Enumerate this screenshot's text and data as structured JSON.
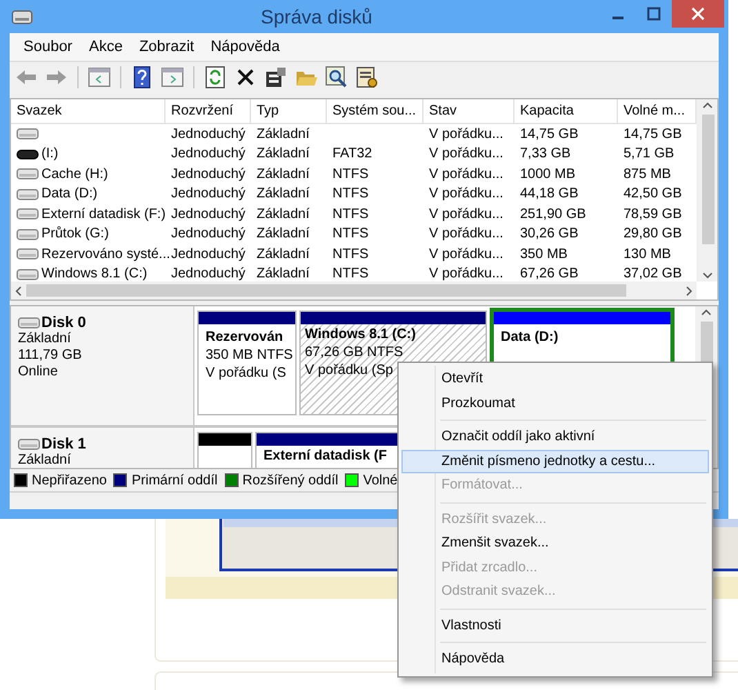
{
  "window": {
    "title": "Správa disků"
  },
  "menu_bar": [
    "Soubor",
    "Akce",
    "Zobrazit",
    "Nápověda"
  ],
  "volume_table": {
    "columns": [
      "Svazek",
      "Rozvržení",
      "Typ",
      "Systém sou...",
      "Stav",
      "Kapacita",
      "Volné m..."
    ],
    "rows": [
      {
        "kind": "disk",
        "layout": "Jednoduchý",
        "type": "Základní",
        "status": "V pořádku...",
        "capacity": "14,75 GB",
        "free": "14,75 GB"
      },
      {
        "kind": "removable",
        "name": "(I:)",
        "layout": "Jednoduchý",
        "type": "Základní",
        "fs": "FAT32",
        "status": "V pořádku...",
        "capacity": "7,33 GB",
        "free": "5,71 GB"
      },
      {
        "kind": "disk",
        "name": "Cache (H:)",
        "layout": "Jednoduchý",
        "type": "Základní",
        "fs": "NTFS",
        "status": "V pořádku...",
        "capacity": "1000 MB",
        "free": "875 MB"
      },
      {
        "kind": "disk",
        "name": "Data (D:)",
        "layout": "Jednoduchý",
        "type": "Základní",
        "fs": "NTFS",
        "status": "V pořádku...",
        "capacity": "44,18 GB",
        "free": "42,50 GB"
      },
      {
        "kind": "disk",
        "name": "Externí datadisk (F:)",
        "layout": "Jednoduchý",
        "type": "Základní",
        "fs": "NTFS",
        "status": "V pořádku...",
        "capacity": "251,90 GB",
        "free": "78,59 GB"
      },
      {
        "kind": "disk",
        "name": "Průtok (G:)",
        "layout": "Jednoduchý",
        "type": "Základní",
        "fs": "NTFS",
        "status": "V pořádku...",
        "capacity": "30,26 GB",
        "free": "29,80 GB"
      },
      {
        "kind": "disk",
        "name": "Rezervováno systé...",
        "layout": "Jednoduchý",
        "type": "Základní",
        "fs": "NTFS",
        "status": "V pořádku...",
        "capacity": "350 MB",
        "free": "130 MB"
      },
      {
        "kind": "disk",
        "name": "Windows 8.1 (C:)",
        "layout": "Jednoduchý",
        "type": "Základní",
        "fs": "NTFS",
        "status": "V pořádku...",
        "capacity": "67,26 GB",
        "free": "37,02 GB"
      }
    ]
  },
  "disks": [
    {
      "name": "Disk 0",
      "type": "Základní",
      "size": "111,79 GB",
      "status": "Online",
      "partitions": [
        {
          "kind": "primary",
          "selected": false,
          "name": "Rezervován",
          "size_fs": "350 MB NTFS",
          "status": "V pořádku (S"
        },
        {
          "kind": "primary",
          "selected": true,
          "name": "Windows 8.1 (C:)",
          "size_fs": "67,26 GB NTFS",
          "status": "V pořádku (Sp"
        },
        {
          "kind": "logical",
          "selected": false,
          "name": "Data (D:)"
        }
      ]
    },
    {
      "name": "Disk 1",
      "type": "Základní",
      "partitions": [
        {
          "kind": "unallocated",
          "selected": false
        },
        {
          "kind": "primary",
          "selected": false,
          "name": "Externí datadisk (F"
        }
      ]
    }
  ],
  "legend": [
    {
      "label": "Nepřiřazeno",
      "color": "#000000"
    },
    {
      "label": "Primární oddíl",
      "color": "#00007f"
    },
    {
      "label": "Rozšířený oddíl",
      "color": "#008000"
    },
    {
      "label": "Volné",
      "color": "#00ff00"
    }
  ],
  "context_menu": [
    {
      "kind": "item",
      "label": "Otevřít",
      "disabled": false,
      "selected": false
    },
    {
      "kind": "item",
      "label": "Prozkoumat",
      "disabled": false,
      "selected": false
    },
    {
      "kind": "separator"
    },
    {
      "kind": "item",
      "label": "Označit oddíl jako aktivní",
      "disabled": false,
      "selected": false
    },
    {
      "kind": "item",
      "label": "Změnit písmeno jednotky a cestu...",
      "disabled": false,
      "selected": true
    },
    {
      "kind": "item",
      "label": "Formátovat...",
      "disabled": true,
      "selected": false
    },
    {
      "kind": "separator"
    },
    {
      "kind": "item",
      "label": "Rozšířit svazek...",
      "disabled": true,
      "selected": false
    },
    {
      "kind": "item",
      "label": "Zmenšit svazek...",
      "disabled": false,
      "selected": false
    },
    {
      "kind": "item",
      "label": "Přidat zrcadlo...",
      "disabled": true,
      "selected": false
    },
    {
      "kind": "item",
      "label": "Odstranit svazek...",
      "disabled": true,
      "selected": false
    },
    {
      "kind": "separator"
    },
    {
      "kind": "item",
      "label": "Vlastnosti",
      "disabled": false,
      "selected": false
    },
    {
      "kind": "separator"
    },
    {
      "kind": "item",
      "label": "Nápověda",
      "disabled": false,
      "selected": false
    }
  ]
}
